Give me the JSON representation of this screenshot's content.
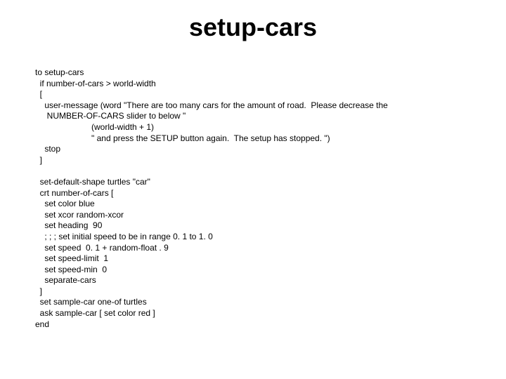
{
  "title": "setup-cars",
  "code": {
    "l01": "to setup-cars",
    "l02": "  if number-of-cars > world-width",
    "l03": "  [",
    "l04": "    user-message (word \"There are too many cars for the amount of road.  Please decrease the",
    "l05": "     NUMBER-OF-CARS slider to below \"",
    "l06": "                        (world-width + 1)",
    "l07": "                        \" and press the SETUP button again.  The setup has stopped. \")",
    "l08": "    stop",
    "l09": "  ]",
    "l10": "",
    "l11": "  set-default-shape turtles \"car\"",
    "l12": "  crt number-of-cars [",
    "l13": "    set color blue",
    "l14": "    set xcor random-xcor",
    "l15": "    set heading  90",
    "l16": "    ; ; ; set initial speed to be in range 0. 1 to 1. 0",
    "l17": "    set speed  0. 1 + random-float . 9",
    "l18": "    set speed-limit  1",
    "l19": "    set speed-min  0",
    "l20": "    separate-cars",
    "l21": "  ]",
    "l22": "  set sample-car one-of turtles",
    "l23": "  ask sample-car [ set color red ]",
    "l24": "end"
  }
}
